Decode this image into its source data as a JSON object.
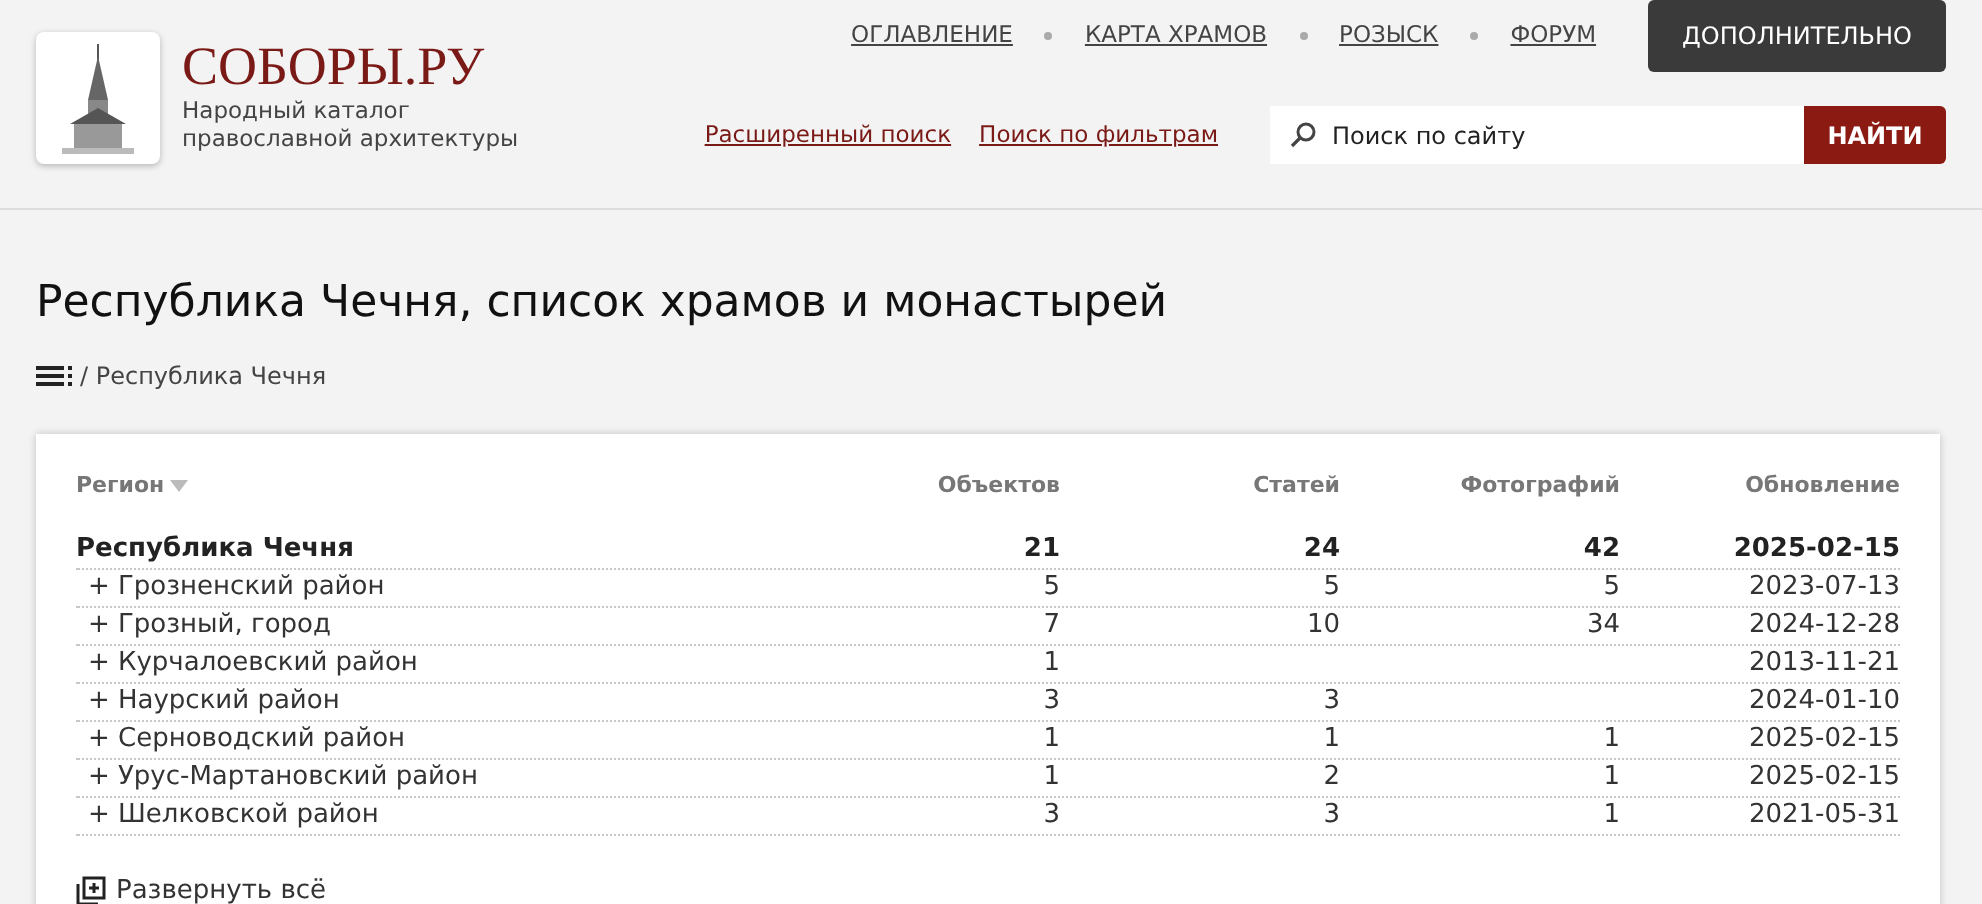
{
  "header": {
    "site_name": "СОБОРЫ.РУ",
    "tagline": "Народный каталог православной архитектуры",
    "nav": [
      {
        "label": "ОГЛАВЛЕНИЕ"
      },
      {
        "label": "КАРТА ХРАМОВ"
      },
      {
        "label": "РОЗЫСК"
      },
      {
        "label": "ФОРУМ"
      }
    ],
    "more_button": "ДОПОЛНИТЕЛЬНО",
    "search_links": [
      "Расширенный поиск",
      "Поиск по фильтрам"
    ],
    "search": {
      "placeholder": "Поиск по сайту",
      "button": "НАЙТИ"
    }
  },
  "page_title": "Республика Чечня, список храмов и монастырей",
  "breadcrumb": "/ Республика Чечня",
  "table": {
    "columns": [
      "Регион",
      "Объектов",
      "Статей",
      "Фотографий",
      "Обновление"
    ],
    "total": {
      "region": "Республика Чечня",
      "objects": "21",
      "articles": "24",
      "photos": "42",
      "updated": "2025-02-15"
    },
    "rows": [
      {
        "expander": "+",
        "region": "Грозненский район",
        "objects": "5",
        "articles": "5",
        "photos": "5",
        "updated": "2023-07-13"
      },
      {
        "expander": "+",
        "region": "Грозный, город",
        "objects": "7",
        "articles": "10",
        "photos": "34",
        "updated": "2024-12-28"
      },
      {
        "expander": "+",
        "region": "Курчалоевский район",
        "objects": "1",
        "updated": "2013-11-21"
      },
      {
        "expander": "+",
        "region": "Наурский район",
        "objects": "3",
        "articles": "3",
        "updated": "2024-01-10"
      },
      {
        "expander": "+",
        "region": "Серноводский район",
        "objects": "1",
        "articles": "1",
        "photos": "1",
        "updated": "2025-02-15"
      },
      {
        "expander": "+",
        "region": "Урус-Мартановский район",
        "objects": "1",
        "articles": "2",
        "photos": "1",
        "updated": "2025-02-15"
      },
      {
        "expander": "+",
        "region": "Шелковской район",
        "objects": "3",
        "articles": "3",
        "photos": "1",
        "updated": "2021-05-31"
      }
    ],
    "expand_all": "Развернуть всё"
  }
}
